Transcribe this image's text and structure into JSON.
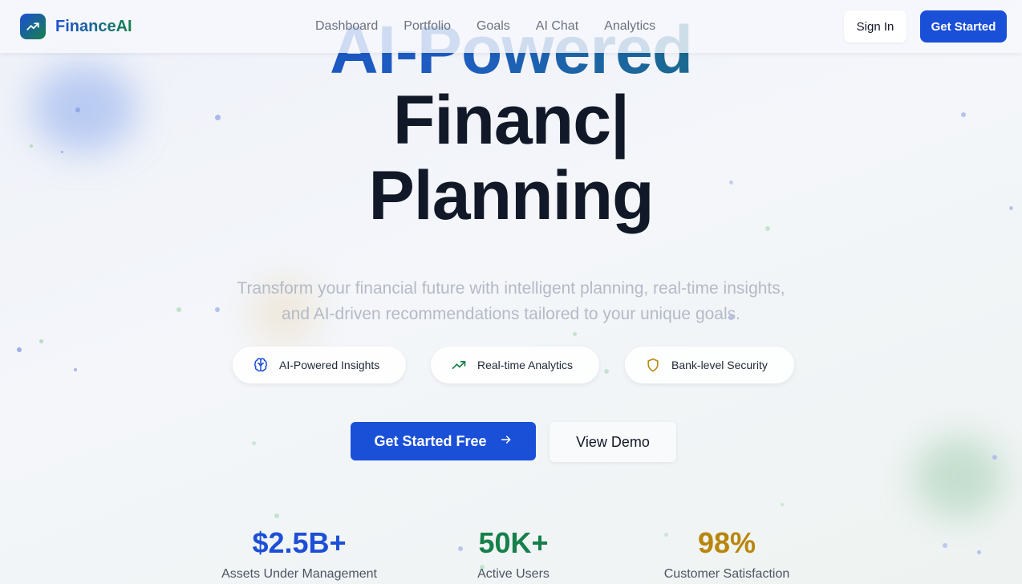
{
  "brand": {
    "name": "FinanceAI",
    "logo_icon": "trending-up-icon"
  },
  "nav": {
    "items": [
      {
        "label": "Dashboard"
      },
      {
        "label": "Portfolio"
      },
      {
        "label": "Goals"
      },
      {
        "label": "AI Chat"
      },
      {
        "label": "Analytics"
      }
    ]
  },
  "header_actions": {
    "signin_label": "Sign In",
    "get_started_label": "Get Started"
  },
  "hero": {
    "headline_line1": "AI-Powered",
    "headline_line2": "Financ|",
    "headline_line3": "Planning",
    "subtitle_line1": "Transform your financial future with intelligent planning, real-time insights,",
    "subtitle_line2": "and AI-driven recommendations tailored to your unique goals."
  },
  "features": [
    {
      "label": "AI-Powered Insights",
      "icon": "brain-icon",
      "color": "#1d4fd6"
    },
    {
      "label": "Real-time Analytics",
      "icon": "trending-up-icon",
      "color": "#16804a"
    },
    {
      "label": "Bank-level Security",
      "icon": "shield-icon",
      "color": "#b8860b"
    }
  ],
  "cta": {
    "primary_label": "Get Started Free",
    "secondary_label": "View Demo"
  },
  "stats": [
    {
      "value": "$2.5B+",
      "label": "Assets Under Management",
      "color": "#1d4fd6"
    },
    {
      "value": "50K+",
      "label": "Active Users",
      "color": "#16804a"
    },
    {
      "value": "98%",
      "label": "Customer Satisfaction",
      "color": "#b8860b"
    }
  ],
  "colors": {
    "primary": "#1a4fd8",
    "green": "#16804a",
    "gold": "#b8860b",
    "heading": "#111827"
  }
}
